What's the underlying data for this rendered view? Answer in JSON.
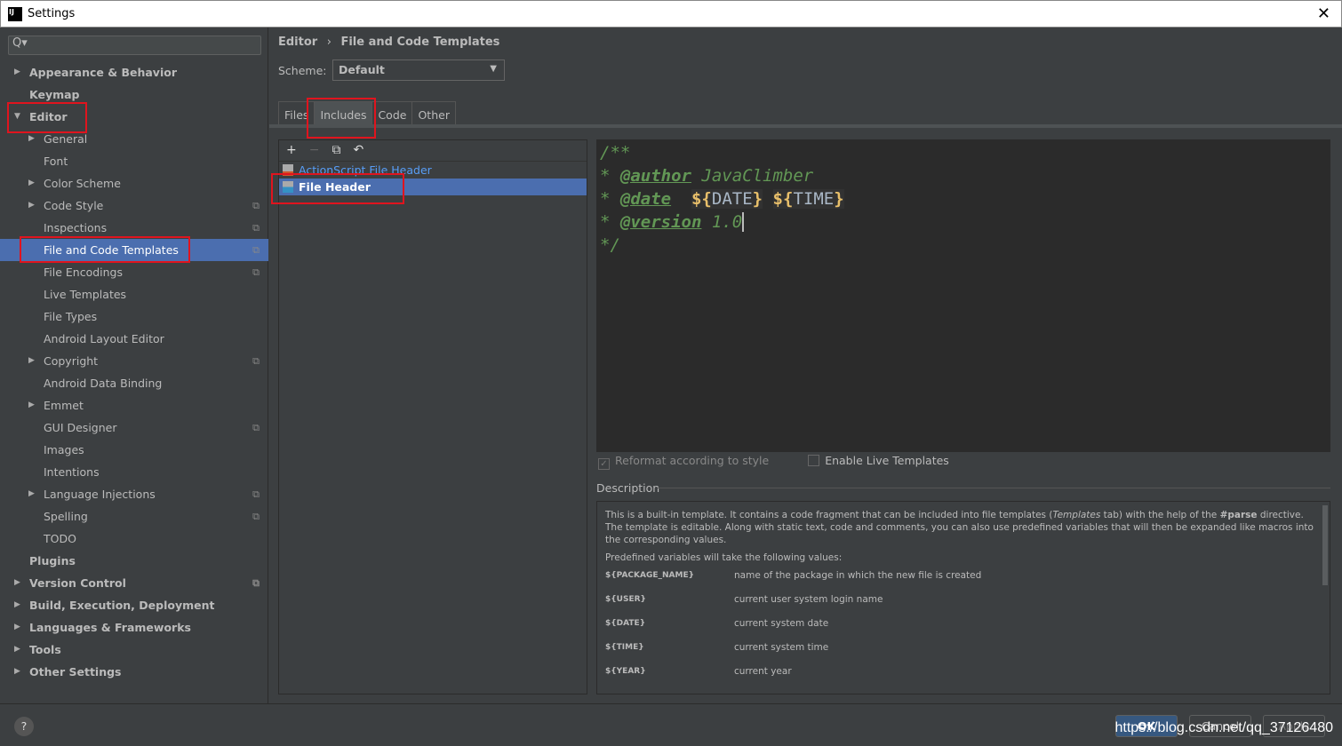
{
  "window": {
    "title": "Settings",
    "close": "✕"
  },
  "search": {
    "icon": "search-icon",
    "value": "Q▾"
  },
  "sidebar": {
    "items": [
      {
        "label": "Appearance & Behavior",
        "level": 0,
        "arrow": "▶",
        "bold": true
      },
      {
        "label": "Keymap",
        "level": 0,
        "bold": true
      },
      {
        "label": "Editor",
        "level": 0,
        "arrow": "▼",
        "bold": true
      },
      {
        "label": "General",
        "level": 1,
        "arrow": "▶"
      },
      {
        "label": "Font",
        "level": 1
      },
      {
        "label": "Color Scheme",
        "level": 1,
        "arrow": "▶"
      },
      {
        "label": "Code Style",
        "level": 1,
        "arrow": "▶",
        "proj": true
      },
      {
        "label": "Inspections",
        "level": 1,
        "proj": true
      },
      {
        "label": "File and Code Templates",
        "level": 1,
        "proj": true,
        "selected": true
      },
      {
        "label": "File Encodings",
        "level": 1,
        "proj": true
      },
      {
        "label": "Live Templates",
        "level": 1
      },
      {
        "label": "File Types",
        "level": 1
      },
      {
        "label": "Android Layout Editor",
        "level": 1
      },
      {
        "label": "Copyright",
        "level": 1,
        "arrow": "▶",
        "proj": true
      },
      {
        "label": "Android Data Binding",
        "level": 1
      },
      {
        "label": "Emmet",
        "level": 1,
        "arrow": "▶"
      },
      {
        "label": "GUI Designer",
        "level": 1,
        "proj": true
      },
      {
        "label": "Images",
        "level": 1
      },
      {
        "label": "Intentions",
        "level": 1
      },
      {
        "label": "Language Injections",
        "level": 1,
        "arrow": "▶",
        "proj": true
      },
      {
        "label": "Spelling",
        "level": 1,
        "proj": true
      },
      {
        "label": "TODO",
        "level": 1
      },
      {
        "label": "Plugins",
        "level": 0,
        "bold": true
      },
      {
        "label": "Version Control",
        "level": 0,
        "arrow": "▶",
        "bold": true,
        "proj": true
      },
      {
        "label": "Build, Execution, Deployment",
        "level": 0,
        "arrow": "▶",
        "bold": true
      },
      {
        "label": "Languages & Frameworks",
        "level": 0,
        "arrow": "▶",
        "bold": true
      },
      {
        "label": "Tools",
        "level": 0,
        "arrow": "▶",
        "bold": true
      },
      {
        "label": "Other Settings",
        "level": 0,
        "arrow": "▶",
        "bold": true
      }
    ]
  },
  "breadcrumb": {
    "parent": "Editor",
    "sep": "›",
    "current": "File and Code Templates"
  },
  "scheme": {
    "label": "Scheme:",
    "value": "Default"
  },
  "tabs": [
    {
      "label": "Files"
    },
    {
      "label": "Includes",
      "active": true
    },
    {
      "label": "Code"
    },
    {
      "label": "Other"
    }
  ],
  "toolbar": {
    "add": "+",
    "remove": "−",
    "copy": "⧉",
    "reset": "↶"
  },
  "templates": [
    {
      "label": "ActionScript File Header"
    },
    {
      "label": "File Header",
      "selected": true
    }
  ],
  "editor": {
    "l1": "/**",
    "star": " * ",
    "author_tag": "@author",
    "author_val": "  JavaClimber",
    "date_tag": "@date",
    "date_var1": "DATE",
    "date_var2": "TIME",
    "version_tag": "@version",
    "version_val": " 1.0",
    "end": " */"
  },
  "options": {
    "reformat": "Reformat according to style",
    "reformat_checked": true,
    "live": "Enable Live Templates",
    "live_checked": false
  },
  "description": {
    "label": "Description",
    "p1a": "This is a built-in template. It contains a code fragment that can be included into file templates (",
    "p1i": "Templates",
    "p1b": " tab) with the help of the ",
    "p1c": "#parse",
    "p1d": " directive.",
    "p2": "The template is editable. Along with static text, code and comments, you can also use predefined variables that will then be expanded like macros into the corresponding values.",
    "p3": "Predefined variables will take the following values:",
    "vars": [
      {
        "name": "${PACKAGE_NAME}",
        "desc": "name of the package in which the new file is created"
      },
      {
        "name": "${USER}",
        "desc": "current user system login name"
      },
      {
        "name": "${DATE}",
        "desc": "current system date"
      },
      {
        "name": "${TIME}",
        "desc": "current system time"
      },
      {
        "name": "${YEAR}",
        "desc": "current year"
      }
    ]
  },
  "footer": {
    "help": "?",
    "ok": "OK",
    "cancel": "Cancel",
    "apply": "Apply",
    "watermark": "https://blog.csdn.net/qq_37126480"
  },
  "colors": {
    "accent": "#4b6eaf",
    "annotation": "#e0141e"
  }
}
